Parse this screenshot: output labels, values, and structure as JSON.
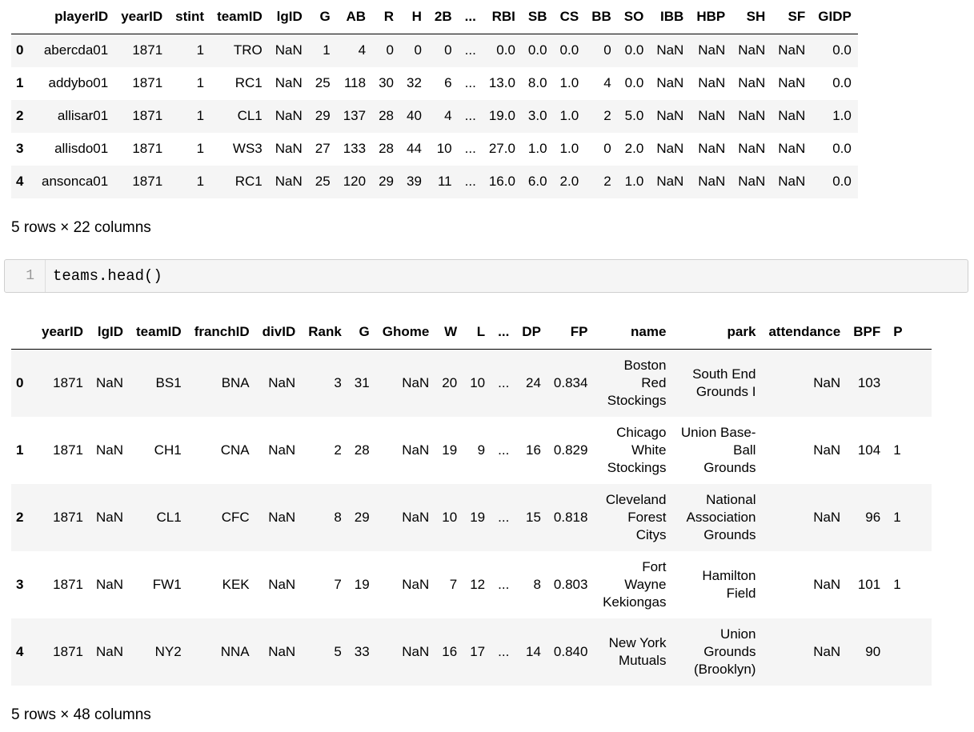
{
  "players_output": {
    "columns": [
      "",
      "playerID",
      "yearID",
      "stint",
      "teamID",
      "lgID",
      "G",
      "AB",
      "R",
      "H",
      "2B",
      "...",
      "RBI",
      "SB",
      "CS",
      "BB",
      "SO",
      "IBB",
      "HBP",
      "SH",
      "SF",
      "GIDP"
    ],
    "rows": [
      [
        "0",
        "abercda01",
        "1871",
        "1",
        "TRO",
        "NaN",
        "1",
        "4",
        "0",
        "0",
        "0",
        "...",
        "0.0",
        "0.0",
        "0.0",
        "0",
        "0.0",
        "NaN",
        "NaN",
        "NaN",
        "NaN",
        "0.0"
      ],
      [
        "1",
        "addybo01",
        "1871",
        "1",
        "RC1",
        "NaN",
        "25",
        "118",
        "30",
        "32",
        "6",
        "...",
        "13.0",
        "8.0",
        "1.0",
        "4",
        "0.0",
        "NaN",
        "NaN",
        "NaN",
        "NaN",
        "0.0"
      ],
      [
        "2",
        "allisar01",
        "1871",
        "1",
        "CL1",
        "NaN",
        "29",
        "137",
        "28",
        "40",
        "4",
        "...",
        "19.0",
        "3.0",
        "1.0",
        "2",
        "5.0",
        "NaN",
        "NaN",
        "NaN",
        "NaN",
        "1.0"
      ],
      [
        "3",
        "allisdo01",
        "1871",
        "1",
        "WS3",
        "NaN",
        "27",
        "133",
        "28",
        "44",
        "10",
        "...",
        "27.0",
        "1.0",
        "1.0",
        "0",
        "2.0",
        "NaN",
        "NaN",
        "NaN",
        "NaN",
        "0.0"
      ],
      [
        "4",
        "ansonca01",
        "1871",
        "1",
        "RC1",
        "NaN",
        "25",
        "120",
        "29",
        "39",
        "11",
        "...",
        "16.0",
        "6.0",
        "2.0",
        "2",
        "1.0",
        "NaN",
        "NaN",
        "NaN",
        "NaN",
        "0.0"
      ]
    ],
    "shape": "5 rows × 22 columns"
  },
  "code_cell": {
    "line_number": "1",
    "code": "teams.head()"
  },
  "teams_output": {
    "columns": [
      "",
      "yearID",
      "lgID",
      "teamID",
      "franchID",
      "divID",
      "Rank",
      "G",
      "Ghome",
      "W",
      "L",
      "...",
      "DP",
      "FP",
      "name",
      "park",
      "attendance",
      "BPF",
      "P"
    ],
    "rows": [
      [
        "0",
        "1871",
        "NaN",
        "BS1",
        "BNA",
        "NaN",
        "3",
        "31",
        "NaN",
        "20",
        "10",
        "...",
        "24",
        "0.834",
        "Boston Red Stockings",
        "South End Grounds I",
        "NaN",
        "103",
        ""
      ],
      [
        "1",
        "1871",
        "NaN",
        "CH1",
        "CNA",
        "NaN",
        "2",
        "28",
        "NaN",
        "19",
        "9",
        "...",
        "16",
        "0.829",
        "Chicago White Stockings",
        "Union Base-Ball Grounds",
        "NaN",
        "104",
        "1"
      ],
      [
        "2",
        "1871",
        "NaN",
        "CL1",
        "CFC",
        "NaN",
        "8",
        "29",
        "NaN",
        "10",
        "19",
        "...",
        "15",
        "0.818",
        "Cleveland Forest Citys",
        "National Association Grounds",
        "NaN",
        "96",
        "1"
      ],
      [
        "3",
        "1871",
        "NaN",
        "FW1",
        "KEK",
        "NaN",
        "7",
        "19",
        "NaN",
        "7",
        "12",
        "...",
        "8",
        "0.803",
        "Fort Wayne Kekiongas",
        "Hamilton Field",
        "NaN",
        "101",
        "1"
      ],
      [
        "4",
        "1871",
        "NaN",
        "NY2",
        "NNA",
        "NaN",
        "5",
        "33",
        "NaN",
        "16",
        "17",
        "...",
        "14",
        "0.840",
        "New York Mutuals",
        "Union Grounds (Brooklyn)",
        "NaN",
        "90",
        ""
      ]
    ],
    "shape": "5 rows × 48 columns"
  }
}
